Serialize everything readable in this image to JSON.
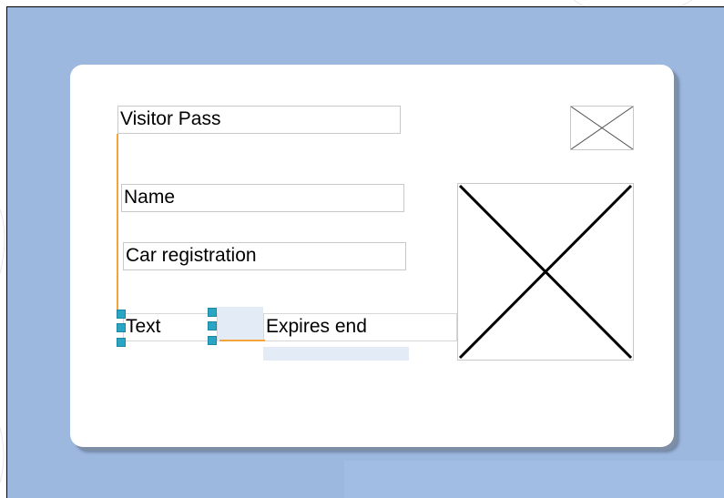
{
  "card": {
    "title_field": "Visitor Pass",
    "name_field": "Name",
    "car_field": "Car registration",
    "text_field": "Text",
    "expires_field": "Expires end"
  },
  "images": {
    "logo": "image-placeholder-icon",
    "photo": "image-placeholder-icon"
  },
  "colors": {
    "canvas": "#9db8df",
    "connector": "#f5a33b",
    "handle": "#2aa6c4"
  }
}
